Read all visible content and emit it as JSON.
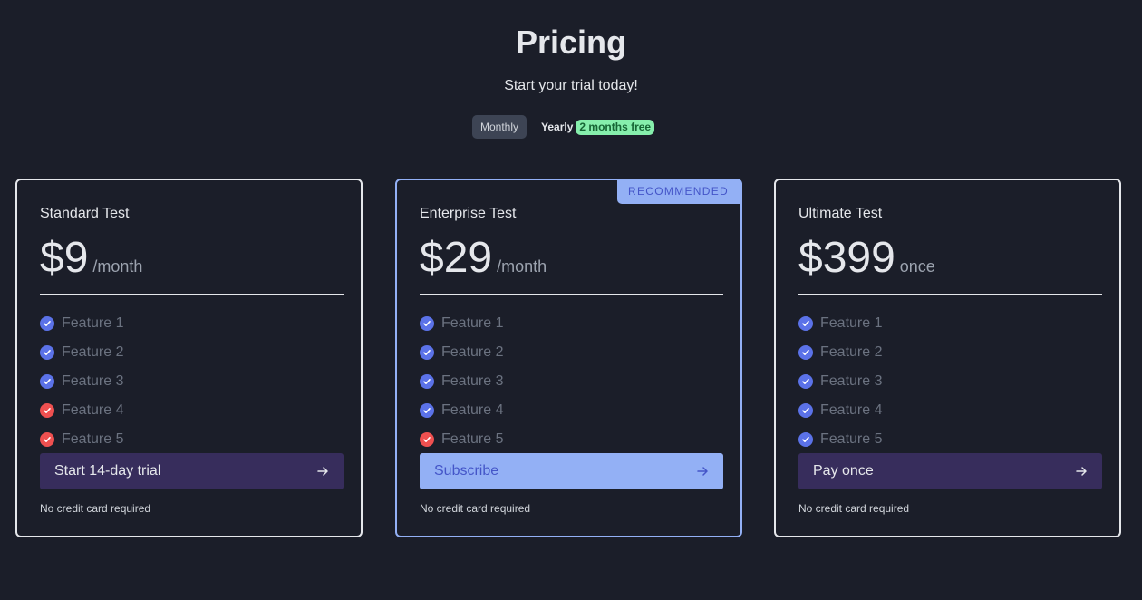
{
  "header": {
    "title": "Pricing",
    "subtitle": "Start your trial today!"
  },
  "billing_toggle": {
    "monthly_label": "Monthly",
    "yearly_label": "Yearly",
    "yearly_badge": "2 months free",
    "selected": "Monthly"
  },
  "plans": [
    {
      "name": "Standard Test",
      "price": "$9",
      "period": "/month",
      "features": [
        {
          "label": "Feature 1",
          "included": true
        },
        {
          "label": "Feature 2",
          "included": true
        },
        {
          "label": "Feature 3",
          "included": true
        },
        {
          "label": "Feature 4",
          "included": false
        },
        {
          "label": "Feature 5",
          "included": false
        }
      ],
      "cta_label": "Start 14-day trial",
      "note": "No credit card required"
    },
    {
      "name": "Enterprise Test",
      "price": "$29",
      "period": "/month",
      "recommended_label": "RECOMMENDED",
      "features": [
        {
          "label": "Feature 1",
          "included": true
        },
        {
          "label": "Feature 2",
          "included": true
        },
        {
          "label": "Feature 3",
          "included": true
        },
        {
          "label": "Feature 4",
          "included": true
        },
        {
          "label": "Feature 5",
          "included": false
        }
      ],
      "cta_label": "Subscribe",
      "note": "No credit card required"
    },
    {
      "name": "Ultimate Test",
      "price": "$399",
      "period": "once",
      "features": [
        {
          "label": "Feature 1",
          "included": true
        },
        {
          "label": "Feature 2",
          "included": true
        },
        {
          "label": "Feature 3",
          "included": true
        },
        {
          "label": "Feature 4",
          "included": true
        },
        {
          "label": "Feature 5",
          "included": true
        }
      ],
      "cta_label": "Pay once",
      "note": "No credit card required"
    }
  ],
  "colors": {
    "background": "#1b1e29",
    "accent": "#93b0f5",
    "included": "#5b72e8",
    "excluded": "#ef5050",
    "cta": "#372d5c",
    "badge": "#86efac"
  },
  "icons": {
    "included": "check-circle-icon",
    "excluded": "x-circle-icon",
    "cta": "arrow-right-icon"
  }
}
